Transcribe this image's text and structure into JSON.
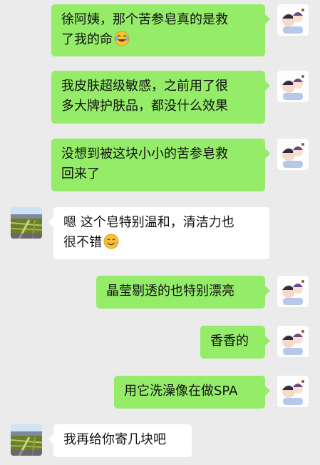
{
  "messages": [
    {
      "side": "right",
      "lines": [
        "徐阿姨，那个苦参皂真的是救",
        "了我的命"
      ],
      "emoji": "laugh-cry-emoji"
    },
    {
      "side": "right",
      "lines": [
        "我皮肤超级敏感，之前用了很",
        "多大牌护肤品，都没什么效果"
      ]
    },
    {
      "side": "right",
      "lines": [
        "没想到被这块小小的苦参皂救",
        "回来了"
      ]
    },
    {
      "side": "left",
      "lines": [
        "嗯 这个皂特别温和，清洁力也",
        "很不错"
      ],
      "emoji": "smile-emoji"
    },
    {
      "side": "right",
      "lines": [
        "晶莹剔透的也特别漂亮"
      ]
    },
    {
      "side": "right",
      "lines": [
        "香香的"
      ]
    },
    {
      "side": "right",
      "lines": [
        "用它洗澡像在做SPA"
      ]
    },
    {
      "side": "left",
      "lines": [
        "我再给你寄几块吧"
      ]
    }
  ],
  "colors": {
    "background": "#ebebeb",
    "bubble_self": "#95ec69",
    "bubble_other": "#ffffff"
  }
}
